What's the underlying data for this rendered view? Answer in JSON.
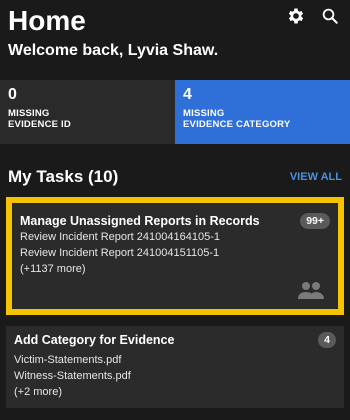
{
  "header": {
    "title": "Home",
    "welcome": "Welcome back, Lyvia Shaw."
  },
  "stats": [
    {
      "value": "0",
      "label_line1": "MISSING",
      "label_line2": "EVIDENCE ID"
    },
    {
      "value": "4",
      "label_line1": "MISSING",
      "label_line2": "EVIDENCE CATEGORY"
    }
  ],
  "tasks": {
    "title": "My Tasks (10)",
    "view_all": "VIEW ALL",
    "items": [
      {
        "title": "Manage Unassigned Reports in Records",
        "badge": "99+",
        "lines": [
          "Review Incident Report 241004164105-1",
          "Review Incident Report 241004151105-1",
          "(+1137 more)"
        ]
      },
      {
        "title": "Add Category for Evidence",
        "badge": "4",
        "lines": [
          "Victim-Statements.pdf",
          "Witness-Statements.pdf",
          "(+2 more)"
        ]
      }
    ]
  },
  "colors": {
    "background": "#1a1a1a",
    "accent_blue": "#2e6fd8",
    "highlight_yellow": "#f5c400",
    "link_blue": "#4a90e2"
  }
}
